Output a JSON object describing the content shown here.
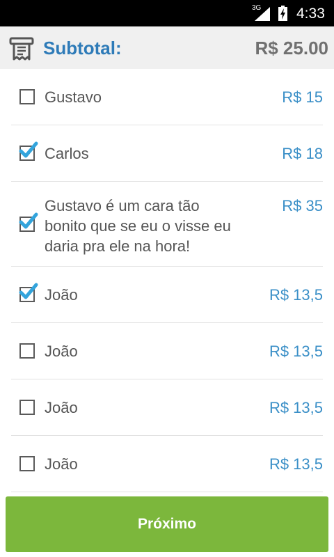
{
  "status_bar": {
    "network": "3G",
    "time": "4:33",
    "icons": [
      "signal-icon",
      "battery-charging-icon"
    ]
  },
  "header": {
    "icon": "receipt-icon",
    "subtotal_label": "Subtotal:",
    "subtotal_value": "R$ 25.00",
    "colors": {
      "label": "#2e7bb8",
      "value": "#707070",
      "background": "#f0f0f0"
    }
  },
  "items": [
    {
      "label": "Gustavo",
      "price": "R$ 15",
      "checked": false
    },
    {
      "label": "Carlos",
      "price": "R$ 18",
      "checked": true
    },
    {
      "label": "Gustavo é um cara tão bonito que se eu o visse eu daria pra ele na hora!",
      "price": "R$ 35",
      "checked": true
    },
    {
      "label": "João",
      "price": "R$ 13,5",
      "checked": true
    },
    {
      "label": "João",
      "price": "R$ 13,5",
      "checked": false
    },
    {
      "label": "João",
      "price": "R$ 13,5",
      "checked": false
    },
    {
      "label": "João",
      "price": "R$ 13,5",
      "checked": false
    }
  ],
  "next_button": {
    "label": "Próximo",
    "color": "#7cb73c"
  },
  "colors": {
    "price": "#3a8fc7",
    "check_accent": "#33a4dc"
  }
}
